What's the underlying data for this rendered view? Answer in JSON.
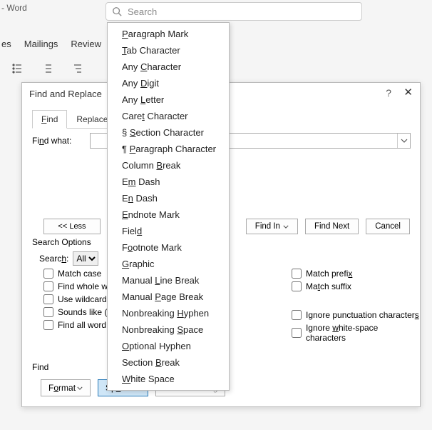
{
  "app": {
    "title_suffix": "- Word"
  },
  "search": {
    "placeholder": "Search"
  },
  "ribbon": {
    "tabs_partial": [
      "es",
      "Mailings",
      "Review"
    ]
  },
  "dialog": {
    "title": "Find and Replace",
    "tabs": {
      "find": "Find",
      "replace": "Replace"
    },
    "find_what_label": "Find what:",
    "less_btn": "<< Less",
    "find_in_btn": "Find In",
    "find_next_btn": "Find Next",
    "cancel_btn": "Cancel",
    "search_options_label": "Search Options",
    "search_dir_label": "Search:",
    "search_dir_value": "All",
    "checks_left": [
      "Match case",
      "Find whole w",
      "Use wildcard",
      "Sounds like (",
      "Find all word"
    ],
    "checks_right_top": [
      "Match prefix",
      "Match suffix"
    ],
    "checks_right_bottom": [
      "Ignore punctuation characters",
      "Ignore white-space characters"
    ],
    "find_section_label": "Find",
    "format_btn": "Format",
    "special_btn": "Special",
    "no_formatting_btn": "No Formatting"
  },
  "special_menu": [
    "Paragraph Mark",
    "Tab Character",
    "Any Character",
    "Any Digit",
    "Any Letter",
    "Caret Character",
    "§ Section Character",
    "¶ Paragraph Character",
    "Column Break",
    "Em Dash",
    "En Dash",
    "Endnote Mark",
    "Field",
    "Footnote Mark",
    "Graphic",
    "Manual Line Break",
    "Manual Page Break",
    "Nonbreaking Hyphen",
    "Nonbreaking Space",
    "Optional Hyphen",
    "Section Break",
    "White Space"
  ],
  "special_menu_underline_index": [
    0,
    0,
    4,
    4,
    4,
    4,
    2,
    2,
    7,
    1,
    1,
    0,
    4,
    1,
    0,
    7,
    7,
    12,
    12,
    0,
    8,
    0
  ]
}
